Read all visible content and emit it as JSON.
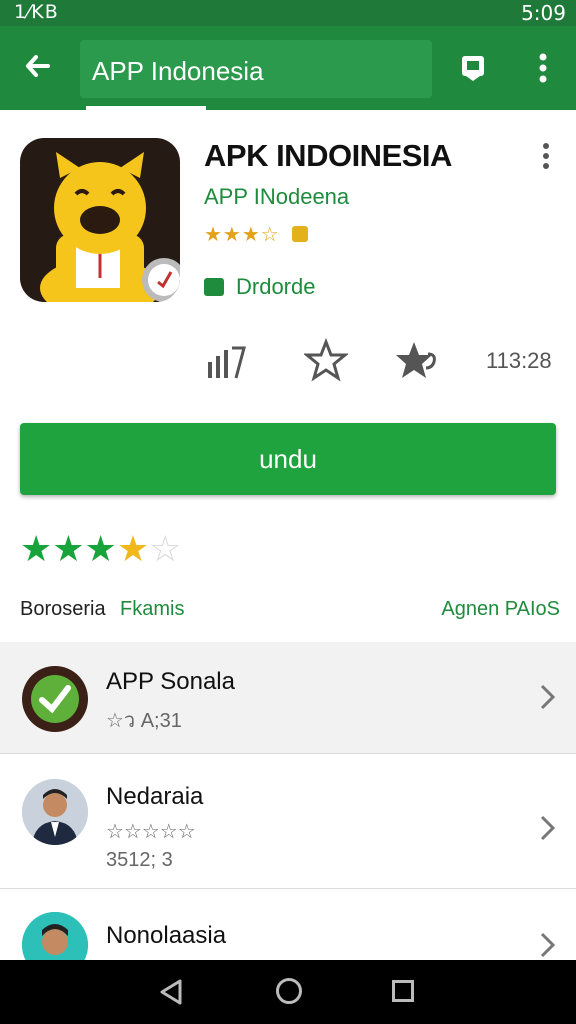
{
  "status_bar": {
    "left": "1⁄ΚΒ",
    "icons": "ᐁ◢ ◢",
    "time": "5:09"
  },
  "toolbar": {
    "search_text": "APP Indonesia"
  },
  "app": {
    "title": "APK INDOINESIA",
    "developer": "APP INodeena",
    "rating_stars": "★★★☆",
    "install_tag": "Drdorde"
  },
  "stats": {
    "number": "113:28"
  },
  "install_button": {
    "label": "undu"
  },
  "rating": {
    "green_stars": "★★★",
    "yellow_stars": "★",
    "empty_stars": "☆"
  },
  "links": {
    "left_dark": "Boroseria",
    "left_green": "Fkamis",
    "right": "Agnen PAIoS"
  },
  "list": [
    {
      "title": "APP Sonala",
      "sub": "☆ว A;31",
      "sub2": ""
    },
    {
      "title": "Nedaraia",
      "sub": "☆☆☆☆☆",
      "sub2": "3512; 3"
    },
    {
      "title": "Nonolaasia",
      "sub": "",
      "sub2": ""
    }
  ],
  "colors": {
    "primary": "#1f8a3e",
    "accent_green": "#1e8c3c",
    "star_yellow": "#f0b81a"
  }
}
